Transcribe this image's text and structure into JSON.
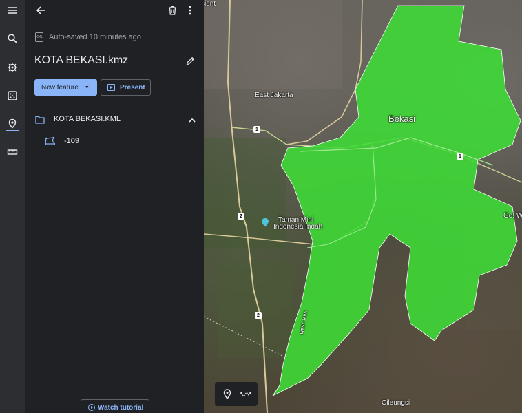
{
  "rail": {
    "items": [
      {
        "name": "menu-icon"
      },
      {
        "name": "search-icon"
      },
      {
        "name": "voyager-icon"
      },
      {
        "name": "dice-icon"
      },
      {
        "name": "projects-icon",
        "active": true
      },
      {
        "name": "ruler-icon"
      }
    ]
  },
  "panel": {
    "autosave_badge": "KML",
    "autosave_text": "Auto-saved 10 minutes ago",
    "title": "KOTA BEKASI.kmz",
    "new_feature_label": "New feature",
    "present_label": "Present",
    "folder_label": "KOTA BEKASI.KML",
    "feature_label": "-109",
    "watch_tutorial_label": "Watch tutorial"
  },
  "map": {
    "labels": {
      "top_left_fragment": "sient",
      "east_jakarta": "East Jakarta",
      "bekasi": "Bekasi",
      "taman_mini": "Taman Mini",
      "indonesia_indah": "Indonesia Indah",
      "west_java": "WEST JAVA",
      "right_fragment": "Go! We",
      "cileungsi": "Cileungsi"
    },
    "shields": {
      "a": "1",
      "b": "1",
      "c": "2",
      "d": "2"
    },
    "region_color": "#3ddc36"
  },
  "colors": {
    "accent": "#8ab4f8",
    "panel_bg": "#202124",
    "rail_bg": "#2d2e31"
  }
}
